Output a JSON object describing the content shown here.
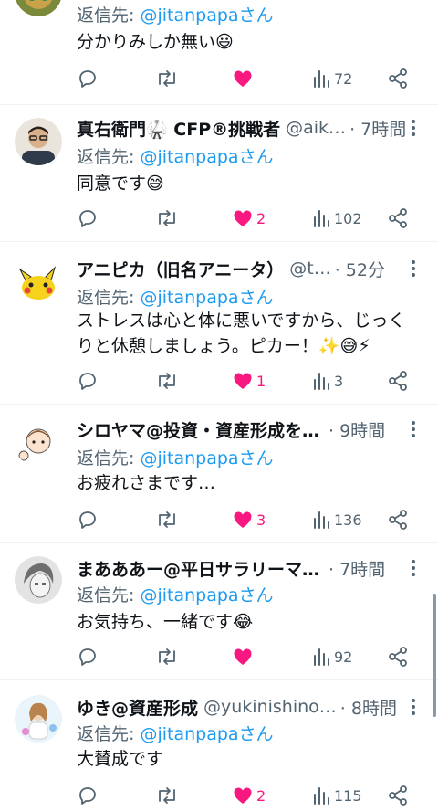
{
  "reply_prefix": "返信先: ",
  "tweets": [
    {
      "user": "",
      "handle": "",
      "time": "",
      "reply_to": "@jitanpapaさん",
      "text": "分かりみしか無い😃",
      "replies": "",
      "retweets": "",
      "likes": "",
      "liked": true,
      "views": "72"
    },
    {
      "user": "真右衛門🥋 CFP®挑戦者",
      "handle": "@aik…",
      "time": "· 7時間",
      "reply_to": "@jitanpapaさん",
      "text": "同意です😅",
      "replies": "",
      "retweets": "",
      "likes": "2",
      "liked": true,
      "views": "102"
    },
    {
      "user": "アニピカ（旧名アニータ）",
      "handle": "@t…",
      "time": "· 52分",
      "reply_to": "@jitanpapaさん",
      "text": "ストレスは心と体に悪いですから、じっくりと休憩しましょう。ピカー！✨😅⚡",
      "replies": "",
      "retweets": "",
      "likes": "1",
      "liked": true,
      "views": "3"
    },
    {
      "user": "シロヤマ@投資・資産形成を…",
      "handle": "",
      "time": "· 9時間",
      "reply_to": "@jitanpapaさん",
      "text": "お疲れさまです…",
      "replies": "",
      "retweets": "",
      "likes": "3",
      "liked": true,
      "views": "136"
    },
    {
      "user": "まあああー@平日サラリーマ…",
      "handle": "",
      "time": "· 7時間",
      "reply_to": "@jitanpapaさん",
      "text": "お気持ち、一緒です😂",
      "replies": "",
      "retweets": "",
      "likes": "",
      "liked": true,
      "views": "92"
    },
    {
      "user": "ゆき@資産形成",
      "handle": "@yukinishino…",
      "time": "· 8時間",
      "reply_to": "@jitanpapaさん",
      "text": "大賛成です",
      "replies": "",
      "retweets": "",
      "likes": "2",
      "liked": true,
      "views": "115"
    }
  ],
  "colors": {
    "like": "#f91880",
    "mention": "#1d9bf0",
    "muted": "#536471"
  }
}
